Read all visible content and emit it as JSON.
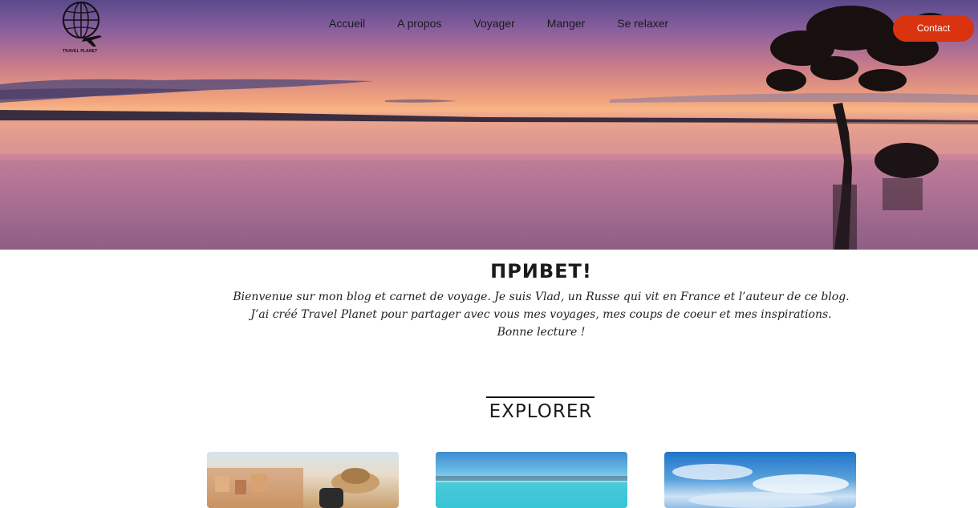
{
  "header": {
    "logo_text": "TRAVEL PLANET",
    "logo_icon": "globe-plane-icon",
    "nav": [
      {
        "label": "Accueil"
      },
      {
        "label": "A propos"
      },
      {
        "label": "Voyager"
      },
      {
        "label": "Manger"
      },
      {
        "label": "Se relaxer"
      }
    ],
    "contact_label": "Contact"
  },
  "welcome": {
    "title": "ПРИВЕТ!",
    "line1": "Bienvenue sur mon blog et carnet de voyage. Je suis Vlad, un Russe qui vit en France et l’auteur de ce blog.",
    "line2": "J’ai créé Travel Planet pour partager avec vous mes voyages, mes coups de coeur et mes inspirations.",
    "line3": "Bonne lecture !"
  },
  "explorer": {
    "title": "EXPLORER",
    "cards": [
      {
        "name": "city-traveler-photo"
      },
      {
        "name": "tropical-beach-photo"
      },
      {
        "name": "blue-sky-photo"
      }
    ]
  },
  "colors": {
    "accent": "#d9330f",
    "hero_top": "#5a4a8a",
    "hero_horizon": "#f7b587"
  }
}
